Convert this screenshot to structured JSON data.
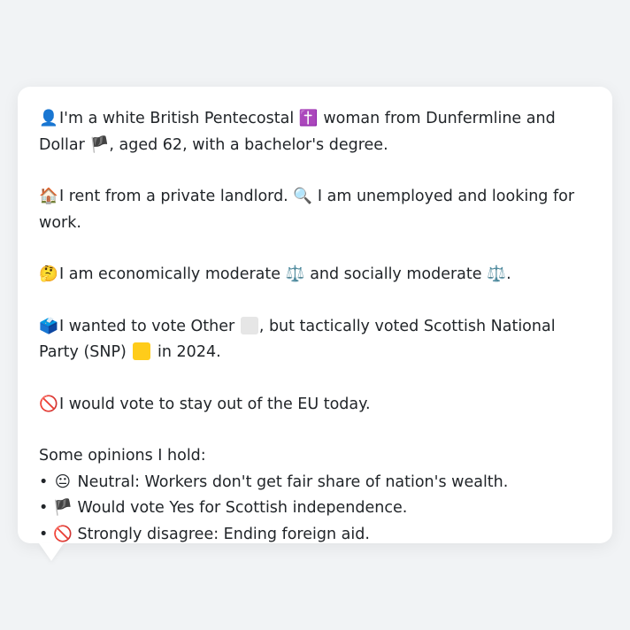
{
  "profile": {
    "intro": {
      "icon": "👤",
      "text_a": "I'm a white British Pentecostal",
      "religion_icon": "✝️",
      "text_b": "woman from Dunfermline and Dollar",
      "flag_icon": "🏴",
      "text_c": ", aged 62, with a bachelor's degree."
    },
    "housing": {
      "icon": "🏠",
      "text_a": "I rent from a private landlord.",
      "work_icon": "🔍",
      "text_b": "I am unemployed and looking for work."
    },
    "views": {
      "icon": "🤔",
      "text_a": "I am economically moderate",
      "scale_icon_1": "⚖️",
      "text_b": "and socially moderate",
      "scale_icon_2": "⚖️",
      "text_c": "."
    },
    "vote": {
      "icon": "🗳️",
      "text_a": "I wanted to vote Other",
      "text_b": ", but tactically voted Scottish National Party (SNP)",
      "text_c": "in 2024.",
      "other_color": "#e6e6e6",
      "snp_color": "#ffcc1a"
    },
    "eu": {
      "icon": "🚫",
      "text": "I would vote to stay out of the EU today."
    },
    "opinions": {
      "heading": "Some opinions I hold:",
      "items": [
        {
          "bullet": "•",
          "icon": "😐",
          "text": "Neutral: Workers don't get fair share of nation's wealth."
        },
        {
          "bullet": "•",
          "icon": "🏴",
          "text": "Would vote Yes for Scottish independence."
        },
        {
          "bullet": "•",
          "icon": "🚫",
          "text": "Strongly disagree: Ending foreign aid."
        }
      ]
    }
  }
}
